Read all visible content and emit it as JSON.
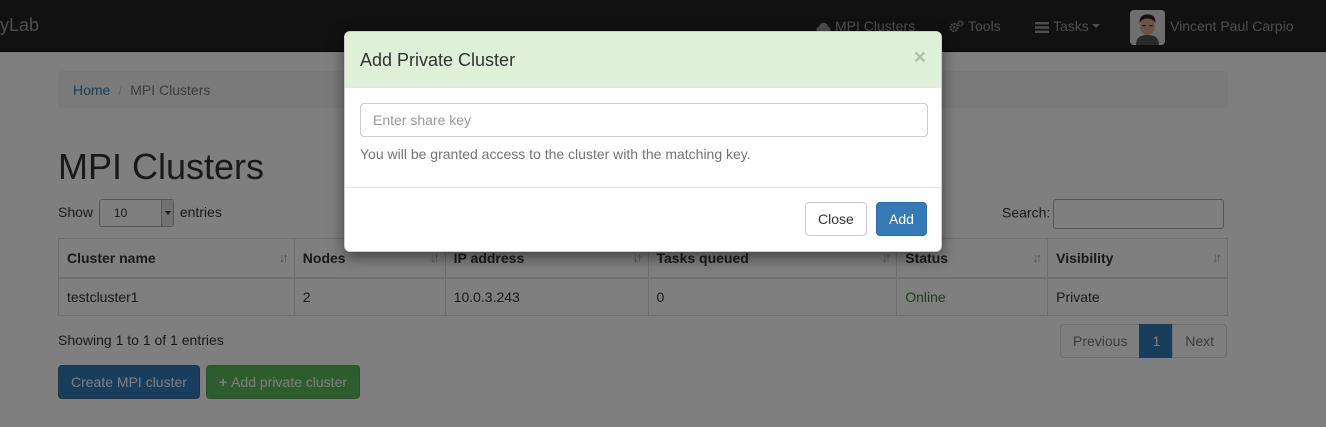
{
  "navbar": {
    "brand": "yLab",
    "items": [
      {
        "label": "MPI Clusters",
        "icon": "cloud-icon"
      },
      {
        "label": "Tools",
        "icon": "cogs-icon"
      },
      {
        "label": "Tasks",
        "icon": "tasks-icon"
      }
    ],
    "user": {
      "name": "Vincent Paul Carpio",
      "avatar": "avatar"
    }
  },
  "breadcrumb": {
    "home": "Home",
    "current": "MPI Clusters"
  },
  "page_title": "MPI Clusters",
  "length_menu": {
    "before": "Show",
    "selected": "10",
    "after": "entries"
  },
  "search": {
    "label": "Search:"
  },
  "table": {
    "headers": [
      "Cluster name",
      "Nodes",
      "IP address",
      "Tasks queued",
      "Status",
      "Visibility"
    ],
    "rows": [
      [
        "testcluster1",
        "2",
        "10.0.3.243",
        "0",
        "Online",
        "Private"
      ]
    ]
  },
  "info": "Showing 1 to 1 of 1 entries",
  "pagination": {
    "previous": "Previous",
    "page": "1",
    "next": "Next"
  },
  "actions": {
    "create": "Create MPI cluster",
    "add_private": "Add private cluster"
  },
  "modal": {
    "title": "Add Private Cluster",
    "close_glyph": "×",
    "input_placeholder": "Enter share key",
    "input_value": "",
    "help": "You will be granted access to the cluster with the matching key.",
    "close_button": "Close",
    "add_button": "Add"
  },
  "colors": {
    "primary": "#337ab7",
    "success": "#5cb85c",
    "online": "#3c763d",
    "modal_header": "#dff0d8",
    "navbar": "#222222"
  }
}
